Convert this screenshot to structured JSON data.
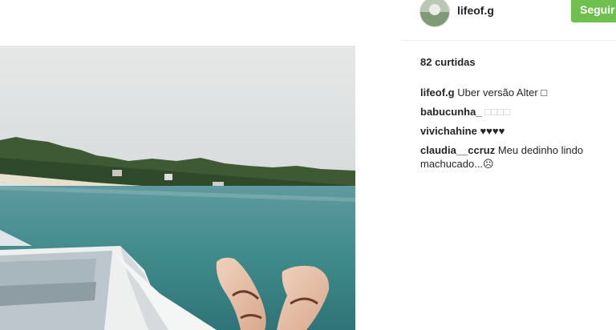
{
  "post": {
    "username": "lifeof.g",
    "follow_label": "Seguir",
    "likes_text": "82 curtidas"
  },
  "comments": [
    {
      "author": "lifeof.g",
      "text": "Uber versão Alter □"
    },
    {
      "author": "babucunha_",
      "text": "□□□□"
    },
    {
      "author": "vivichahine",
      "text": "♥♥♥♥"
    },
    {
      "author": "claudia__ccruz",
      "text": "Meu dedinho lindo machucado...☹"
    }
  ],
  "colors": {
    "follow_button": "#70c050",
    "text": "#262626"
  }
}
